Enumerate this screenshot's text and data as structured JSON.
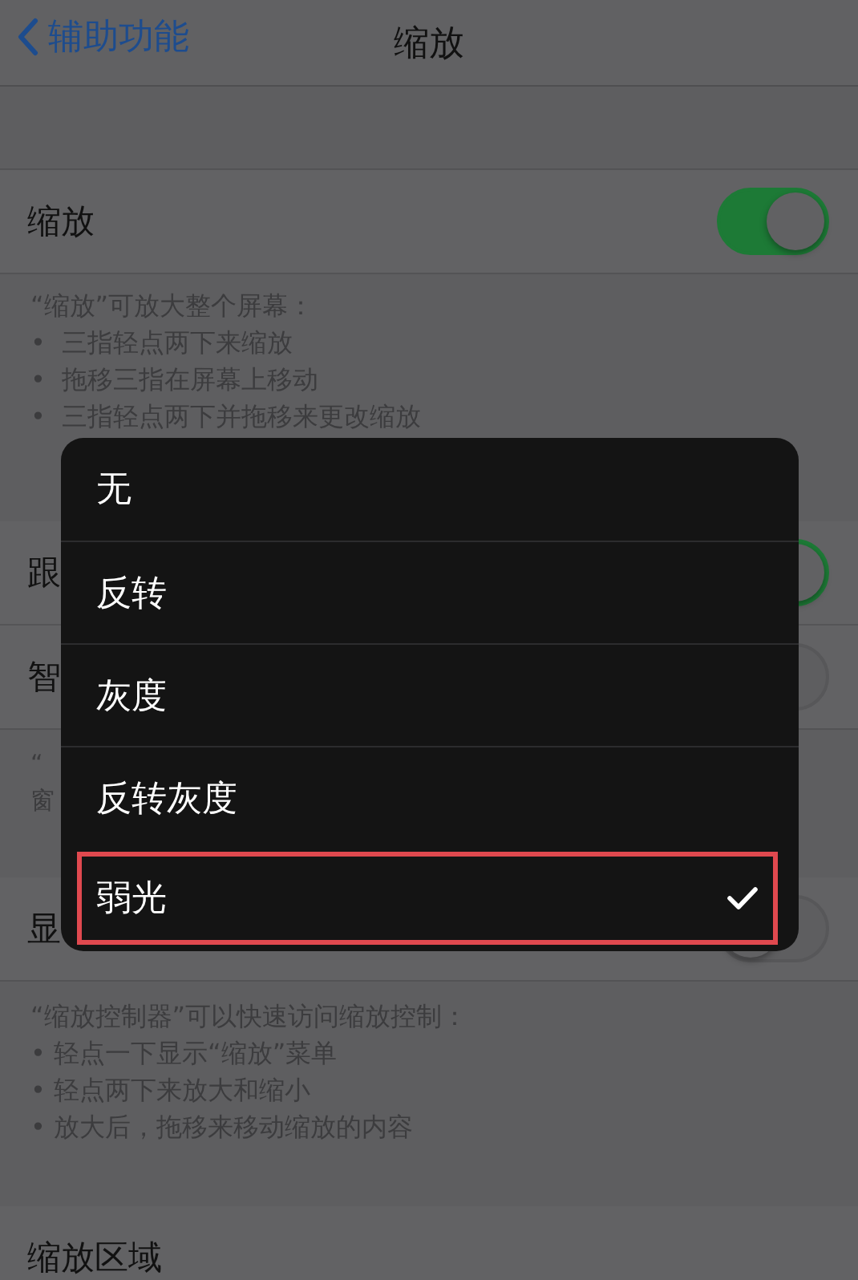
{
  "nav": {
    "back": "辅助功能",
    "title": "缩放"
  },
  "groups": [
    {
      "rows": [
        {
          "label": "缩放",
          "kind": "toggle",
          "on": true
        }
      ],
      "footer": [
        "“缩放”可放大整个屏幕：",
        "•  三指轻点两下来缩放",
        "•  拖移三指在屏幕上移动",
        "•  三指轻点两下并拖移来更改缩放"
      ]
    },
    {
      "rows": [
        {
          "label": "跟",
          "kind": "toggle",
          "on": true
        },
        {
          "label": "智",
          "kind": "toggle",
          "on": false
        }
      ],
      "footer": [
        "“",
        "窗"
      ]
    },
    {
      "rows": [
        {
          "label": "显",
          "kind": "toggle",
          "on": false
        }
      ],
      "footer": [
        "“缩放控制器”可以快速访问缩放控制：",
        "• 轻点一下显示“缩放”菜单",
        "• 轻点两下来放大和缩小",
        "• 放大后，拖移来移动缩放的内容"
      ]
    },
    {
      "rows": [
        {
          "label": "缩放区域",
          "kind": "plain"
        }
      ]
    }
  ],
  "menu": {
    "options": [
      {
        "label": "无",
        "selected": false
      },
      {
        "label": "反转",
        "selected": false
      },
      {
        "label": "灰度",
        "selected": false
      },
      {
        "label": "反转灰度",
        "selected": false
      },
      {
        "label": "弱光",
        "selected": true
      }
    ]
  }
}
